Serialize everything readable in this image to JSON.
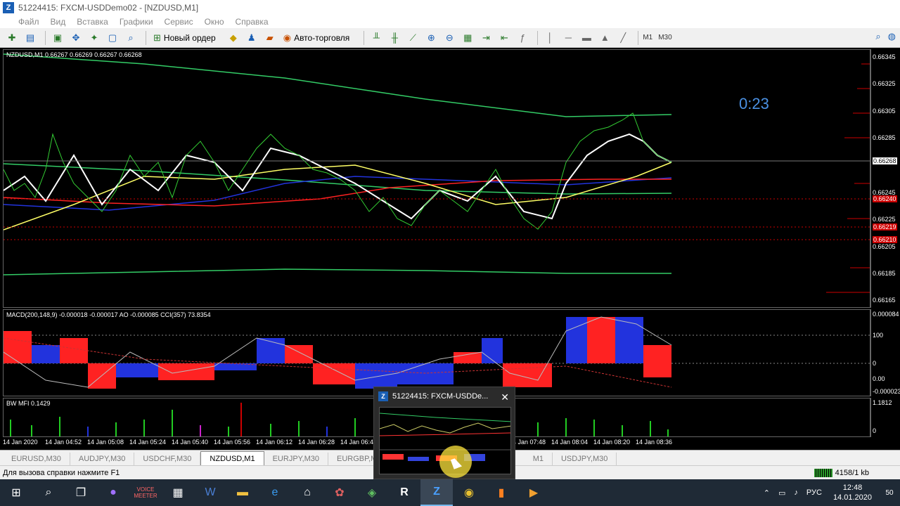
{
  "window": {
    "title": "51224415: FXCM-USDDemo02 - [NZDUSD,M1]"
  },
  "menu": [
    "Файл",
    "Вид",
    "Вставка",
    "Графики",
    "Сервис",
    "Окно",
    "Справка"
  ],
  "toolbar": {
    "new_order": "Новый ордер",
    "auto_trading": "Авто-торговля",
    "tf_m1": "M1",
    "tf_m30": "M30"
  },
  "chart": {
    "main_label": "NZDUSD,M1  0.66267 0.66269 0.66267 0.66268",
    "timer": "0:23",
    "price_labels": [
      "0.66345",
      "0.66325",
      "0.66305",
      "0.66285",
      "0.66268",
      "0.66245",
      "0.66240",
      "0.66225",
      "0.66219",
      "0.66210",
      "0.66205",
      "0.66185",
      "0.66165"
    ],
    "indicator_label": "MACD(200,148,9) -0.000018 -0.000017  AO -0.000085  CCI(357) 73.8354",
    "indicator_scale": [
      "0.000084",
      "100",
      "0",
      "0.00",
      "-0.000023"
    ],
    "mfi_label": "BW MFI 0.1429",
    "mfi_scale": [
      "1.1812",
      "0"
    ],
    "time_labels": [
      "14 Jan 2020",
      "14 Jan 04:52",
      "14 Jan 05:08",
      "14 Jan 05:24",
      "14 Jan 05:40",
      "14 Jan 05:56",
      "14 Jan 06:12",
      "14 Jan 06:28",
      "14 Jan 06:44",
      "14 Jan 07:48",
      "14 Jan 08:04",
      "14 Jan 08:20",
      "14 Jan 08:36"
    ]
  },
  "tabs": [
    "EURUSD,M30",
    "AUDJPY,M30",
    "USDCHF,M30",
    "NZDUSD,M1",
    "EURJPY,M30",
    "EURGBP,M1",
    "AU",
    "M1",
    "USDJPY,M30"
  ],
  "active_tab": "NZDUSD,M1",
  "status": {
    "help": "Для вызова справки нажмите F1",
    "traffic": "4158/1 kb"
  },
  "preview": {
    "title": "51224415: FXCM-USDDe..."
  },
  "taskbar": {
    "lang": "РУС",
    "time": "12:48",
    "date": "14.01.2020",
    "notifications": "50",
    "voice_label": "VOICE MEETER",
    "r_label": "R"
  },
  "colors": {
    "chart_bg": "#000000",
    "bull": "#0000ff",
    "bear": "#ff0000",
    "ma_white": "#ffffff",
    "ma_yellow": "#ffff66",
    "ma_green": "#33cc66",
    "timer": "#4a90e2"
  }
}
